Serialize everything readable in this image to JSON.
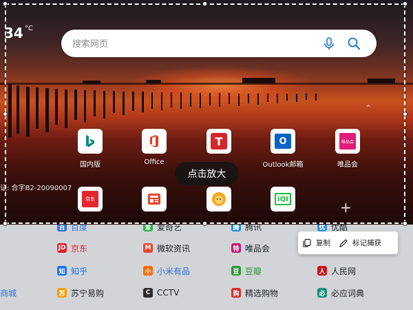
{
  "weather": {
    "temp": "34",
    "unit": "°C"
  },
  "search": {
    "placeholder": "搜索网页"
  },
  "tiles_row1": [
    {
      "label": "国内版",
      "icon": "bing-icon"
    },
    {
      "label": "Office",
      "icon": "office-icon"
    },
    {
      "label": "",
      "icon": "t-icon"
    },
    {
      "label": "Outlook邮箱",
      "icon": "outlook-icon"
    },
    {
      "label": "唯品会",
      "icon": "vip-icon"
    }
  ],
  "tiles_row2": [
    {
      "label": "京东",
      "icon": "jd-icon"
    },
    {
      "label": "",
      "icon": "news-icon"
    },
    {
      "label": "",
      "icon": "lion-icon"
    },
    {
      "label": "",
      "icon": "iqiyi-icon"
    }
  ],
  "icp": "证: 合字B2-20090007",
  "zoom_tooltip": "点击放大",
  "toolbar": {
    "copy": "复制",
    "mark": "标记捕获"
  },
  "links": [
    {
      "label": "百度",
      "color": "#2f6fdd"
    },
    {
      "label": "爱奇艺",
      "color": "#2fb143"
    },
    {
      "label": "腾讯",
      "color": "#1d8dd6"
    },
    {
      "label": "优酷",
      "color": "#2f91e0"
    },
    {
      "label": "京东",
      "color": "#d7232a"
    },
    {
      "label": "微软资讯",
      "color": "#e34a33"
    },
    {
      "label": "唯品会",
      "color": "#c71b6b"
    },
    {
      "label": "知乎",
      "color": "#1772f6"
    },
    {
      "label": "小米有品",
      "color": "#ff6900"
    },
    {
      "label": "豆瓣",
      "color": "#2e963d"
    },
    {
      "label": "人民网",
      "color": "#c8161d"
    },
    {
      "label": "商城",
      "color": "#1f2328"
    },
    {
      "label": "苏宁易购",
      "color": "#f6a100"
    },
    {
      "label": "CCTV",
      "color": "#2d2d2d"
    },
    {
      "label": "精选购物",
      "color": "#d92a2a"
    },
    {
      "label": "必应词典",
      "color": "#1d8d7a"
    }
  ]
}
